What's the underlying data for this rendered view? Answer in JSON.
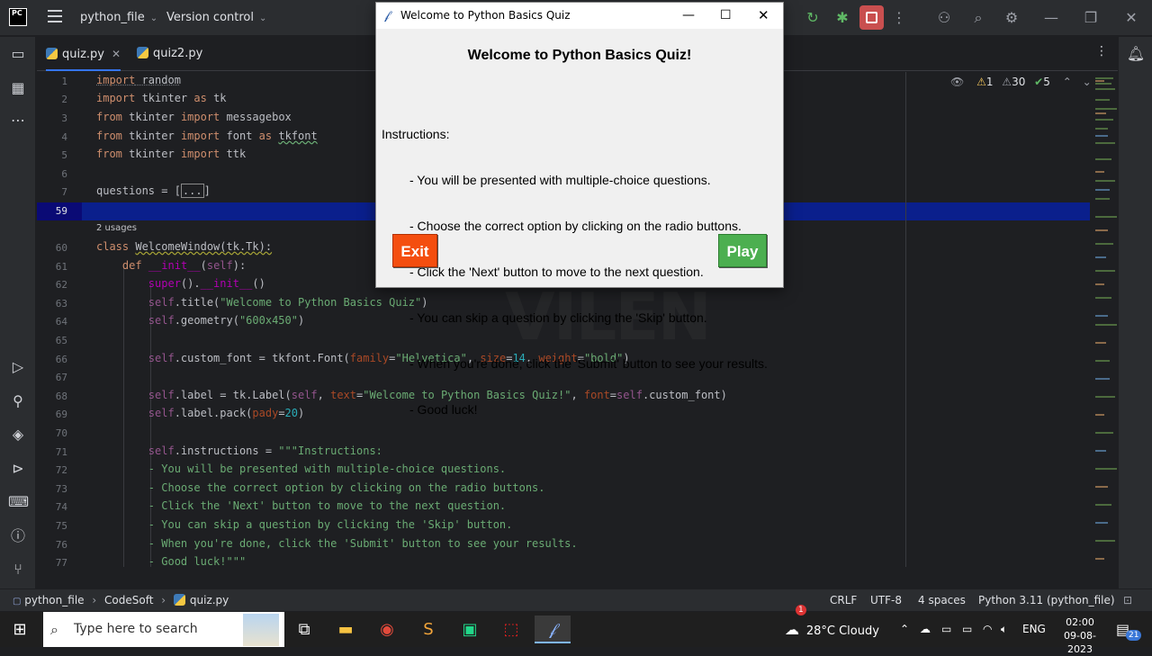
{
  "titlebar": {
    "logo": "PC",
    "project": "python_file",
    "version_control": "Version control"
  },
  "tabs": [
    {
      "label": "quiz.py",
      "active": true
    },
    {
      "label": "quiz2.py",
      "active": false
    }
  ],
  "editor": {
    "line_numbers": [
      "1",
      "2",
      "3",
      "4",
      "5",
      "6",
      "7",
      "59",
      "60",
      "61",
      "62",
      "63",
      "64",
      "65",
      "66",
      "67",
      "68",
      "69",
      "70",
      "71",
      "72",
      "73",
      "74",
      "75",
      "76",
      "77"
    ],
    "usages_hint": "2 usages",
    "inspections": {
      "warnings": "1",
      "weak_warnings": "30",
      "ok": "5"
    },
    "watermark": "VILEN"
  },
  "dialog": {
    "title": "Welcome to Python Basics Quiz",
    "heading": "Welcome to Python Basics Quiz!",
    "instructions_header": "Instructions:",
    "instructions": [
      "- You will be presented with multiple-choice questions.",
      "- Choose the correct option by clicking on the radio buttons.",
      "- Click the 'Next' button to move to the next question.",
      "- You can skip a question by clicking the 'Skip' button.",
      "- When you're done, click the 'Submit' button to see your results.",
      "- Good luck!"
    ],
    "exit_label": "Exit",
    "play_label": "Play"
  },
  "statusbar": {
    "breadcrumb": [
      "python_file",
      "CodeSoft",
      "quiz.py"
    ],
    "line_sep": "CRLF",
    "encoding": "UTF-8",
    "indent": "4 spaces",
    "interpreter": "Python 3.11 (python_file)"
  },
  "taskbar": {
    "search_placeholder": "Type here to search",
    "weather": "28°C  Cloudy",
    "weather_badge": "1",
    "language": "ENG",
    "time": "02:00",
    "date": "09-08-2023",
    "notifications": "21"
  }
}
